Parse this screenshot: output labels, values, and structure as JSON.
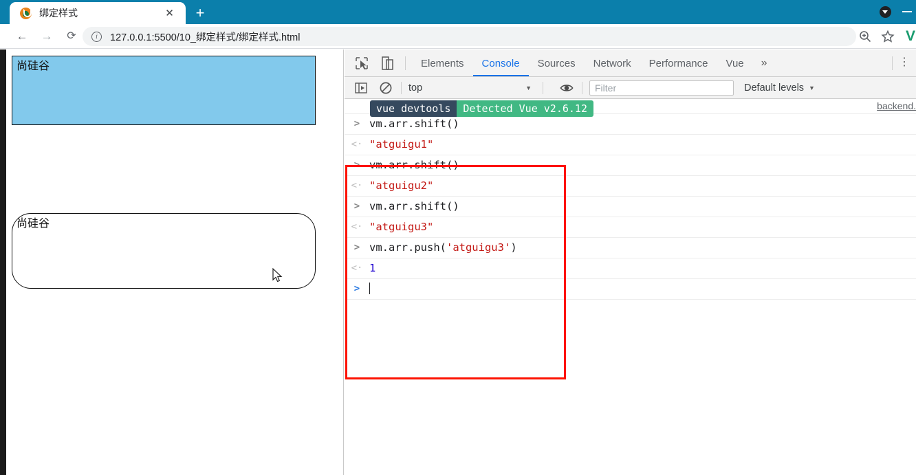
{
  "browser": {
    "tab": {
      "title": "绑定样式",
      "favicon": "vue-favicon-icon",
      "close_label": "✕"
    },
    "new_tab_label": "+",
    "nav": {
      "back": "←",
      "forward": "→",
      "reload": "⟳"
    },
    "omnibox": {
      "url": "127.0.0.1:5500/10_绑定样式/绑定样式.html",
      "info_glyph": "i"
    },
    "extension_badge": "V",
    "titlebar_color": "#0b7fab"
  },
  "page": {
    "box_basic_text": "尚硅谷",
    "box_round_text": "尚硅谷",
    "box_basic_bg": "#82c9ec",
    "box_round_bg": "#ffffff"
  },
  "devtools": {
    "tabs": [
      {
        "label": "Elements",
        "active": false
      },
      {
        "label": "Console",
        "active": true
      },
      {
        "label": "Sources",
        "active": false
      },
      {
        "label": "Network",
        "active": false
      },
      {
        "label": "Performance",
        "active": false
      },
      {
        "label": "Vue",
        "active": false
      }
    ],
    "more_label": "»",
    "kebab_label": "⋮",
    "filterbar": {
      "context": "top",
      "context_caret": "▼",
      "filter_placeholder": "Filter",
      "filter_value": "",
      "levels_label": "Default levels",
      "levels_caret": "▼"
    },
    "notice": {
      "badge_left": "vue devtools",
      "badge_right": "Detected Vue v2.6.12",
      "badge_left_color": "#35495e",
      "badge_right_color": "#41b883",
      "source": "backend."
    },
    "console_rows": [
      {
        "kind": "input",
        "arrow": ">",
        "text": "vm.arr.shift()"
      },
      {
        "kind": "output",
        "arrow": "<·",
        "text": "\"atguigu1\"",
        "token": "string"
      },
      {
        "kind": "input",
        "arrow": ">",
        "text": "vm.arr.shift()"
      },
      {
        "kind": "output",
        "arrow": "<·",
        "text": "\"atguigu2\"",
        "token": "string"
      },
      {
        "kind": "input",
        "arrow": ">",
        "text": "vm.arr.shift()"
      },
      {
        "kind": "output",
        "arrow": "<·",
        "text": "\"atguigu3\"",
        "token": "string"
      },
      {
        "kind": "input",
        "arrow": ">",
        "text": "vm.arr.push('atguigu3')",
        "prefix": "vm.arr.push(",
        "string_part": "'atguigu3'",
        "suffix": ")"
      },
      {
        "kind": "output",
        "arrow": "<·",
        "text": "1",
        "token": "number"
      },
      {
        "kind": "prompt",
        "arrow": ">",
        "text": ""
      }
    ],
    "annotation": {
      "color": "#fd1202",
      "shape": "rectangle"
    }
  }
}
